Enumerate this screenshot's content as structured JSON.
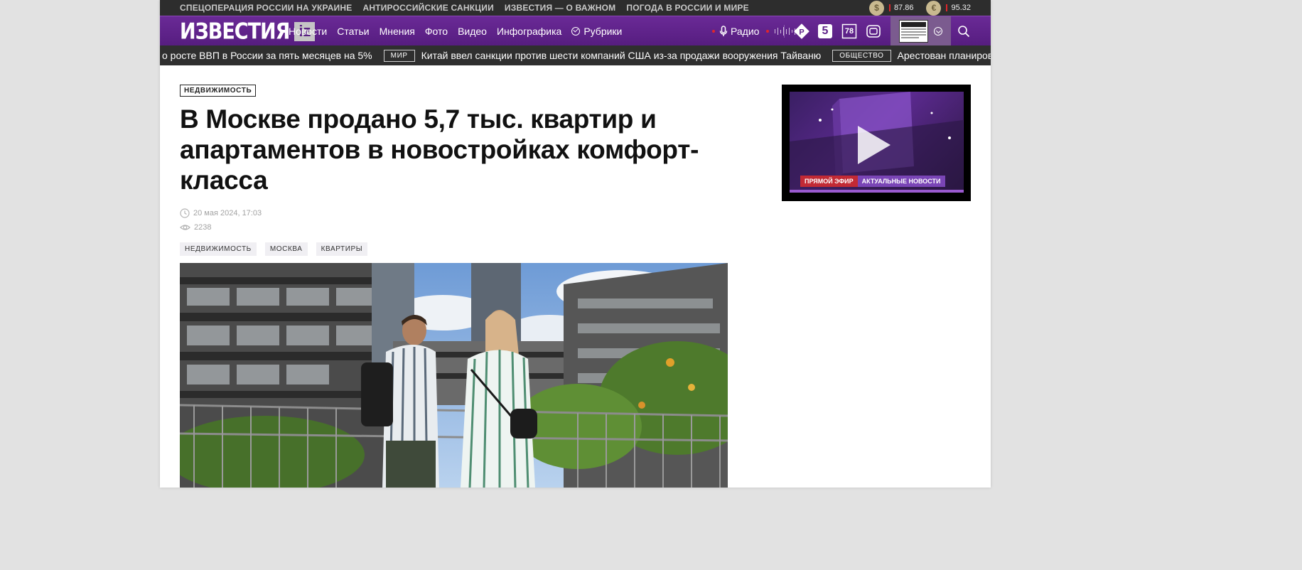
{
  "top_links": [
    "СПЕЦОПЕРАЦИЯ РОССИИ НА УКРАИНЕ",
    "АНТИРОССИЙСКИЕ САНКЦИИ",
    "ИЗВЕСТИЯ — О ВАЖНОМ",
    "ПОГОДА В РОССИИ И МИРЕ"
  ],
  "rates": {
    "usd_symbol": "$",
    "usd": "87.86",
    "eur_symbol": "€",
    "eur": "95.32"
  },
  "logo": {
    "word": "ИЗВЕСТИЯ",
    "badge": "iz"
  },
  "menu": [
    "Новости",
    "Статьи",
    "Мнения",
    "Фото",
    "Видео",
    "Инфографика",
    "Рубрики"
  ],
  "radio_label": "Радио",
  "channels": {
    "ch5": "5",
    "ch78": "78"
  },
  "ticker": {
    "item1": "о росте ВВП в России за пять месяцев на 5%",
    "tag2": "МИР",
    "item2": "Китай ввел санкции против шести компаний США из-за продажи вооружения Тайваню",
    "tag3": "ОБЩЕСТВО",
    "item3": "Арестован планировавший"
  },
  "article": {
    "rubric": "НЕДВИЖИМОСТЬ",
    "title": "В Москве продано 5,7 тыс. квартир и апартаментов в новостройках комфорт-класса",
    "date": "20 мая 2024, 17:03",
    "views": "2238",
    "tags": [
      "НЕДВИЖИМОСТЬ",
      "МОСКВА",
      "КВАРТИРЫ"
    ]
  },
  "video": {
    "live_label": "ПРЯМОЙ ЭФИР",
    "news_label": "АКТУАЛЬНЫЕ НОВОСТИ"
  },
  "colors": {
    "brand_purple": "#5f2389",
    "topbar": "#2d2d2d",
    "ticker": "#2f2f2f",
    "rate_tick": "#e0262b"
  }
}
